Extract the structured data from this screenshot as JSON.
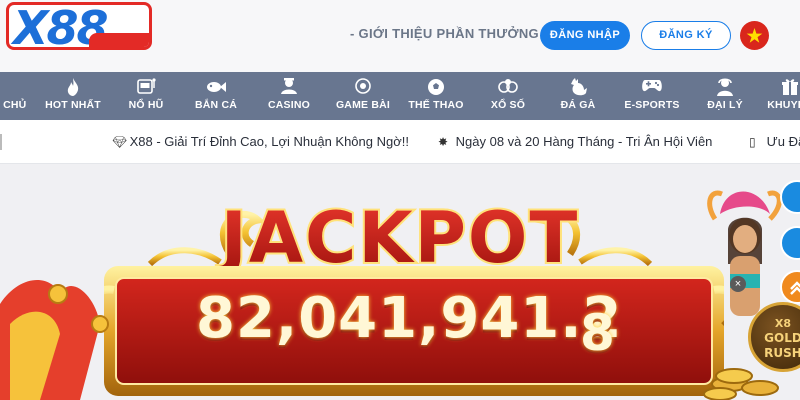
{
  "header": {
    "logo": "X88",
    "intro_link": "- GIỚI THIỆU PHẦN THƯỞNG",
    "login_button": "ĐĂNG NHẬP",
    "register_button": "ĐĂNG KÝ",
    "language_flag": "vietnam-flag-icon"
  },
  "nav": {
    "items": [
      {
        "label": "G CHỦ",
        "icon": "home-icon"
      },
      {
        "label": "HOT NHẤT",
        "icon": "fire-icon"
      },
      {
        "label": "NỔ HŨ",
        "icon": "slot-machine-icon"
      },
      {
        "label": "BẮN CÁ",
        "icon": "fish-icon"
      },
      {
        "label": "CASINO",
        "icon": "dealer-icon"
      },
      {
        "label": "GAME BÀI",
        "icon": "cards-icon"
      },
      {
        "label": "THỂ THAO",
        "icon": "soccer-ball-icon"
      },
      {
        "label": "XỔ SỐ",
        "icon": "lottery-balls-icon"
      },
      {
        "label": "ĐÁ GÀ",
        "icon": "rooster-icon"
      },
      {
        "label": "E-SPORTS",
        "icon": "gamepad-icon"
      },
      {
        "label": "ĐẠI LÝ",
        "icon": "agent-icon"
      },
      {
        "label": "KHUYẾN",
        "icon": "gift-icon"
      }
    ]
  },
  "ticker": {
    "items": [
      {
        "icon": "diamond-icon",
        "text": "X88 - Giải Trí Đỉnh Cao, Lợi Nhuận Không Ngờ!!"
      },
      {
        "icon": "burst-icon",
        "text": "Ngày 08 và 20 Hàng Tháng - Tri Ân Hội Viên"
      },
      {
        "icon": "square-icon",
        "text": "Ưu Đãi"
      }
    ]
  },
  "banner": {
    "jackpot_title": "JACKPOT",
    "jackpot_value": "82,041,941.2",
    "jackpot_last_digit": "8",
    "badge_text_top": "X8",
    "badge_text_mid": "GOLD",
    "badge_text_bot": "RUSH",
    "close_glyph": "×"
  },
  "colors": {
    "brand_blue": "#1a7ee8",
    "brand_red": "#e32a26",
    "nav_bg": "#687690",
    "jackpot_red": "#c11d16",
    "jackpot_gold": "#f4c233"
  }
}
